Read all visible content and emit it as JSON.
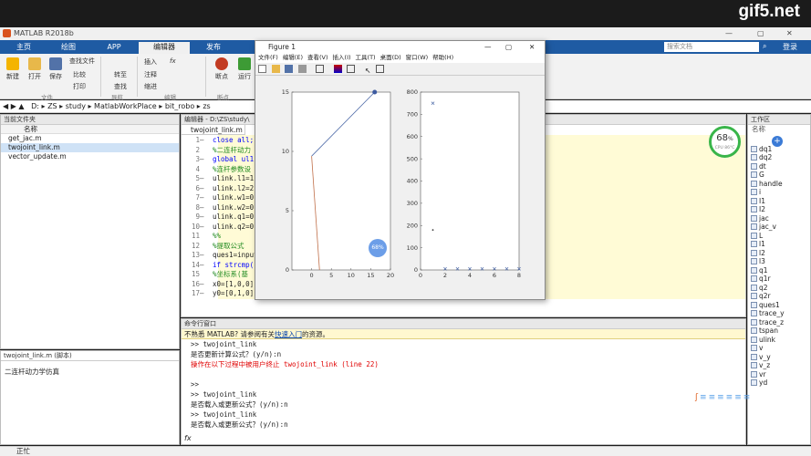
{
  "watermark": "gif5.net",
  "window_title": "MATLAB R2018b",
  "main_tabs": [
    "主页",
    "绘图",
    "APP",
    "编辑器",
    "发布"
  ],
  "search_placeholder": "搜索文档",
  "login": "登录",
  "ribbon": {
    "buttons": [
      "新建",
      "打开",
      "保存",
      "查找文件",
      "比较",
      "打印",
      "转至",
      "查找",
      "插入",
      "fx",
      "注释",
      "缩进",
      "断点",
      "运行"
    ],
    "groups": [
      "文件",
      "导航",
      "编辑",
      "断点"
    ]
  },
  "address_path": [
    "D:",
    "ZS",
    "study",
    "MatlabWorkPlace",
    "bit_robo",
    "zs"
  ],
  "current_folder": {
    "title": "当前文件夹",
    "header": "名称",
    "files": [
      "get_jac.m",
      "twojoint_link.m",
      "vector_update.m"
    ]
  },
  "details": {
    "title": "twojoint_link.m (脚本)",
    "description": "二连杆动力学仿真"
  },
  "editor": {
    "title": "编辑器 - D:\\ZS\\study\\",
    "tab": "twojoint_link.m",
    "lines": [
      {
        "n": "1",
        "m": "—",
        "t": "close all;",
        "c": "kw"
      },
      {
        "n": "2",
        "m": "",
        "t": "%二连杆动力",
        "c": "cm"
      },
      {
        "n": "3",
        "m": "—",
        "t": "global ul1",
        "c": "kw"
      },
      {
        "n": "4",
        "m": "",
        "t": "%连杆参数设",
        "c": "cm"
      },
      {
        "n": "5",
        "m": "—",
        "t": "ulink.l1=1",
        "c": ""
      },
      {
        "n": "6",
        "m": "—",
        "t": "ulink.l2=2",
        "c": ""
      },
      {
        "n": "7",
        "m": "—",
        "t": "ulink.w1=0",
        "c": ""
      },
      {
        "n": "8",
        "m": "—",
        "t": "ulink.w2=0",
        "c": ""
      },
      {
        "n": "9",
        "m": "—",
        "t": "ulink.q1=0",
        "c": ""
      },
      {
        "n": "10",
        "m": "—",
        "t": "ulink.q2=0",
        "c": ""
      },
      {
        "n": "11",
        "m": "",
        "t": "%%",
        "c": "cm"
      },
      {
        "n": "12",
        "m": "",
        "t": "%提取公式",
        "c": "cm"
      },
      {
        "n": "13",
        "m": "—",
        "t": "ques1=input",
        "c": ""
      },
      {
        "n": "14",
        "m": "—",
        "t": "if strcmp(",
        "c": "kw"
      },
      {
        "n": "15",
        "m": "",
        "t": "%坐标系(基",
        "c": "cm"
      },
      {
        "n": "16",
        "m": "—",
        "t": "x0=[1,0,0]",
        "c": ""
      },
      {
        "n": "17",
        "m": "—",
        "t": "y0=[0,1,0]';",
        "c": ""
      }
    ]
  },
  "command_window": {
    "title": "命令行窗口",
    "notice_prefix": "不熟悉 MATLAB? 请参阅有关",
    "notice_link": "快速入门",
    "notice_suffix": "的资源。",
    "lines": [
      {
        "t": ">> twojoint_link",
        "c": ""
      },
      {
        "t": "  是否更新计算公式？(y/n):n",
        "c": ""
      },
      {
        "t": "  操作在以下过程中被用户终止 twojoint_link (line 22)",
        "c": "err"
      },
      {
        "t": "",
        "c": ""
      },
      {
        "t": ">>",
        "c": ""
      },
      {
        "t": ">> twojoint_link",
        "c": ""
      },
      {
        "t": "  是否载入或更新公式？(y/n):n",
        "c": ""
      },
      {
        "t": ">> twojoint_link",
        "c": ""
      },
      {
        "t": "  是否载入或更新公式？(y/n):n",
        "c": ""
      }
    ],
    "prompt": "fx"
  },
  "status": "正忙",
  "workspace": {
    "title": "工作区",
    "header": "名称",
    "vars": [
      "dq1",
      "dq2",
      "dt",
      "G",
      "handle",
      "i",
      "I1",
      "I2",
      "jac",
      "jac_v",
      "L",
      "l1",
      "l2",
      "l3",
      "q1",
      "q1r",
      "q2",
      "q2r",
      "ques1",
      "trace_y",
      "trace_z",
      "tspan",
      "ulink",
      "v",
      "v_y",
      "v_z",
      "vr",
      "yd"
    ]
  },
  "cpu_widget": {
    "percent": "68",
    "unit": "%",
    "label": "CPU 86°C"
  },
  "overlay_badge": "68%",
  "figure": {
    "title": "Figure 1",
    "menu": [
      "文件(F)",
      "编辑(E)",
      "查看(V)",
      "插入(I)",
      "工具(T)",
      "桌面(D)",
      "窗口(W)",
      "帮助(H)"
    ]
  },
  "chart_data": [
    {
      "type": "line",
      "x_ticks": [
        "0",
        "5",
        "10",
        "15",
        "20"
      ],
      "y_ticks": [
        "0",
        "5",
        "10",
        "15"
      ],
      "xlim": [
        -5,
        20
      ],
      "ylim": [
        0,
        15
      ],
      "series": [
        {
          "color": "#4e6aa8",
          "x": [
            0,
            16
          ],
          "y": [
            9.6,
            15
          ]
        },
        {
          "color": "#c0704a",
          "x": [
            0,
            2
          ],
          "y": [
            9.6,
            0
          ]
        }
      ],
      "markers": [
        {
          "x": 16,
          "y": 15
        }
      ]
    },
    {
      "type": "scatter",
      "x_ticks": [
        "0",
        "2",
        "4",
        "6",
        "8"
      ],
      "y_ticks": [
        "0",
        "100",
        "200",
        "300",
        "400",
        "500",
        "600",
        "700",
        "800"
      ],
      "xlim": [
        0,
        8
      ],
      "ylim": [
        0,
        800
      ],
      "points": [
        {
          "x": 1,
          "y": 750,
          "m": "x"
        },
        {
          "x": 1,
          "y": 180,
          "m": "."
        },
        {
          "x": 2,
          "y": 5,
          "m": "x"
        },
        {
          "x": 3,
          "y": 5,
          "m": "x"
        },
        {
          "x": 4,
          "y": 5,
          "m": "x"
        },
        {
          "x": 5,
          "y": 5,
          "m": "x"
        },
        {
          "x": 6,
          "y": 5,
          "m": "x"
        },
        {
          "x": 7,
          "y": 5,
          "m": "x"
        },
        {
          "x": 8,
          "y": 5,
          "m": "x"
        }
      ]
    }
  ]
}
